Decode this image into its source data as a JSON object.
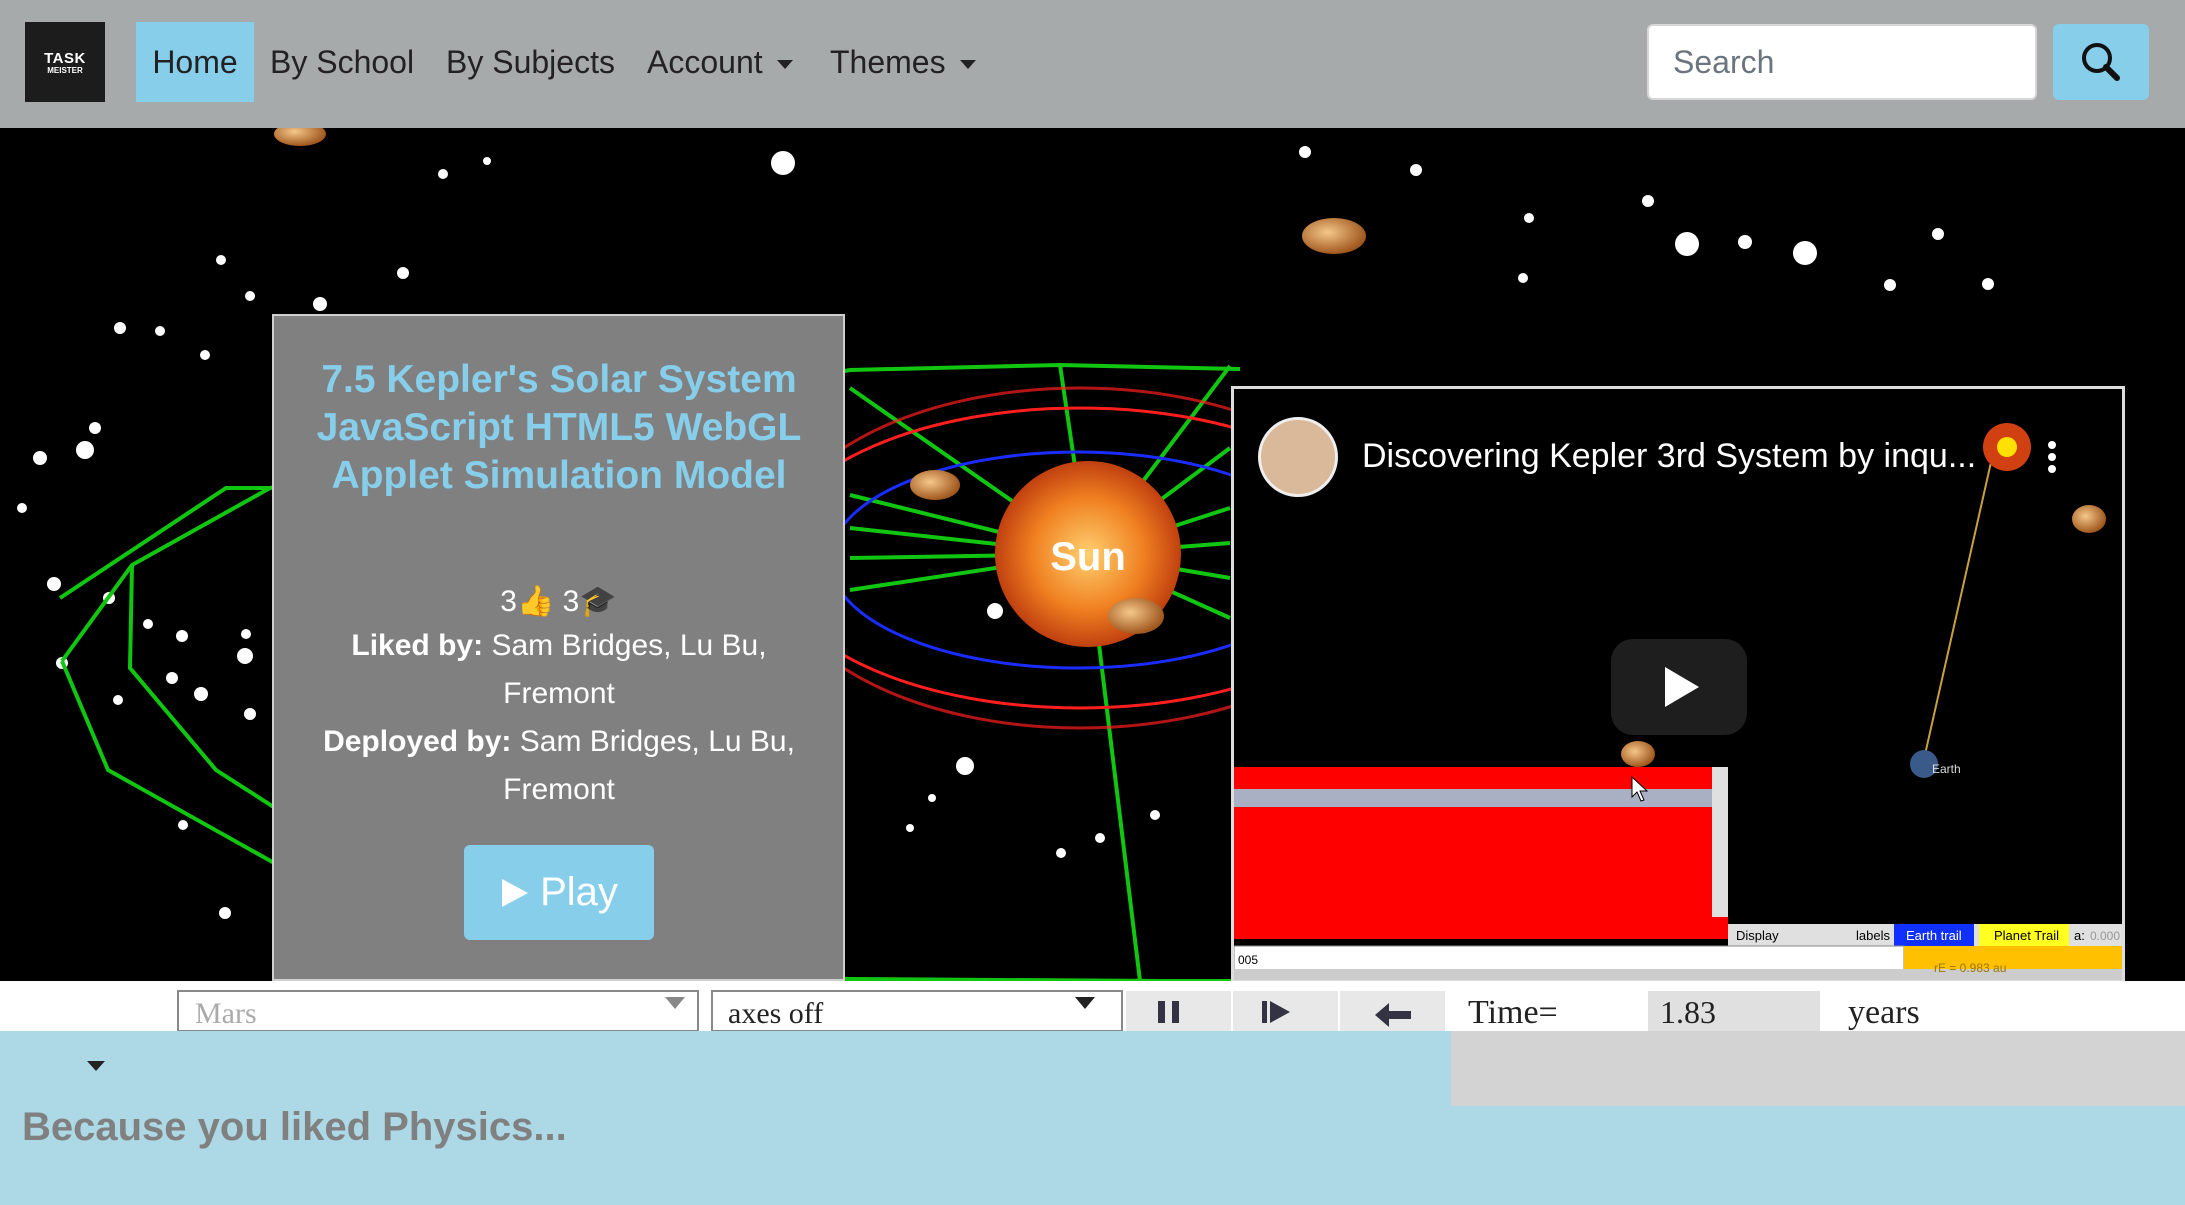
{
  "navbar": {
    "logo_text_1": "TASK",
    "logo_text_2": "MEISTER",
    "items": [
      {
        "label": "Home",
        "active": true
      },
      {
        "label": "By School"
      },
      {
        "label": "By Subjects"
      },
      {
        "label": "Account",
        "has_dropdown": true
      },
      {
        "label": "Themes",
        "has_dropdown": true
      }
    ],
    "search_placeholder": "Search",
    "search_icon": "search-icon"
  },
  "hero": {
    "scene_label": "Sun",
    "card": {
      "title": "7.5 Kepler's Solar System JavaScript HTML5 WebGL Applet Simulation Model",
      "likes": "3",
      "deploys": "3",
      "liked_by_label": "Liked by:",
      "liked_by": "Sam Bridges, Lu Bu, Fremont",
      "deployed_by_label": "Deployed by:",
      "deployed_by": "Sam Bridges, Lu Bu, Fremont",
      "play_label": "Play"
    },
    "video": {
      "title": "Discovering Kepler 3rd System by inqu...",
      "panel_display": "Display",
      "panel_labels": "labels",
      "panel_earth_trail": "Earth trail",
      "panel_planet_trail": "Planet Trail",
      "panel_a": "a:",
      "panel_a_value": "0.000",
      "panel_input": "005",
      "panel_re": "rE = 0.983 au",
      "earth_label": "Earth"
    },
    "carousel_count": 4,
    "controls": {
      "planet": "Mars",
      "axes": "axes off",
      "time_label": "Time=",
      "time_value": "1.83",
      "time_unit": "years"
    }
  },
  "section": {
    "heading": "Because you liked Physics..."
  },
  "colors": {
    "navbar_bg": "#a6aaab",
    "accent": "#87ceeb",
    "page_bg": "#add8e6",
    "card_bg": "#808080",
    "orbit_green": "#11c611",
    "sun_orange": "#f08020",
    "video_panel_red": "#ff0000"
  }
}
